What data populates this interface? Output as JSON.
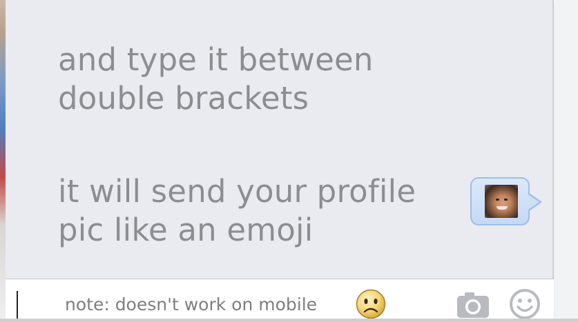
{
  "conversation": {
    "messages": [
      {
        "text": "and type it between\ndouble brackets"
      },
      {
        "text": "it will send your profile\npic like an emoji"
      }
    ],
    "sticker": {
      "icon": "profile-picture-icon"
    }
  },
  "composer": {
    "value": "note: doesn't work on mobile",
    "emoji_icon": "sad-face-emoji",
    "camera_icon": "camera-icon",
    "smiley_icon": "smiley-icon"
  },
  "colors": {
    "panel_background": "#e9ebf0",
    "message_text": "#8c8d91",
    "bubble_fill": "#c6d9f3",
    "bubble_border": "#9fbde6",
    "composer_background": "#ffffff",
    "icon_gray": "#b8babf"
  }
}
